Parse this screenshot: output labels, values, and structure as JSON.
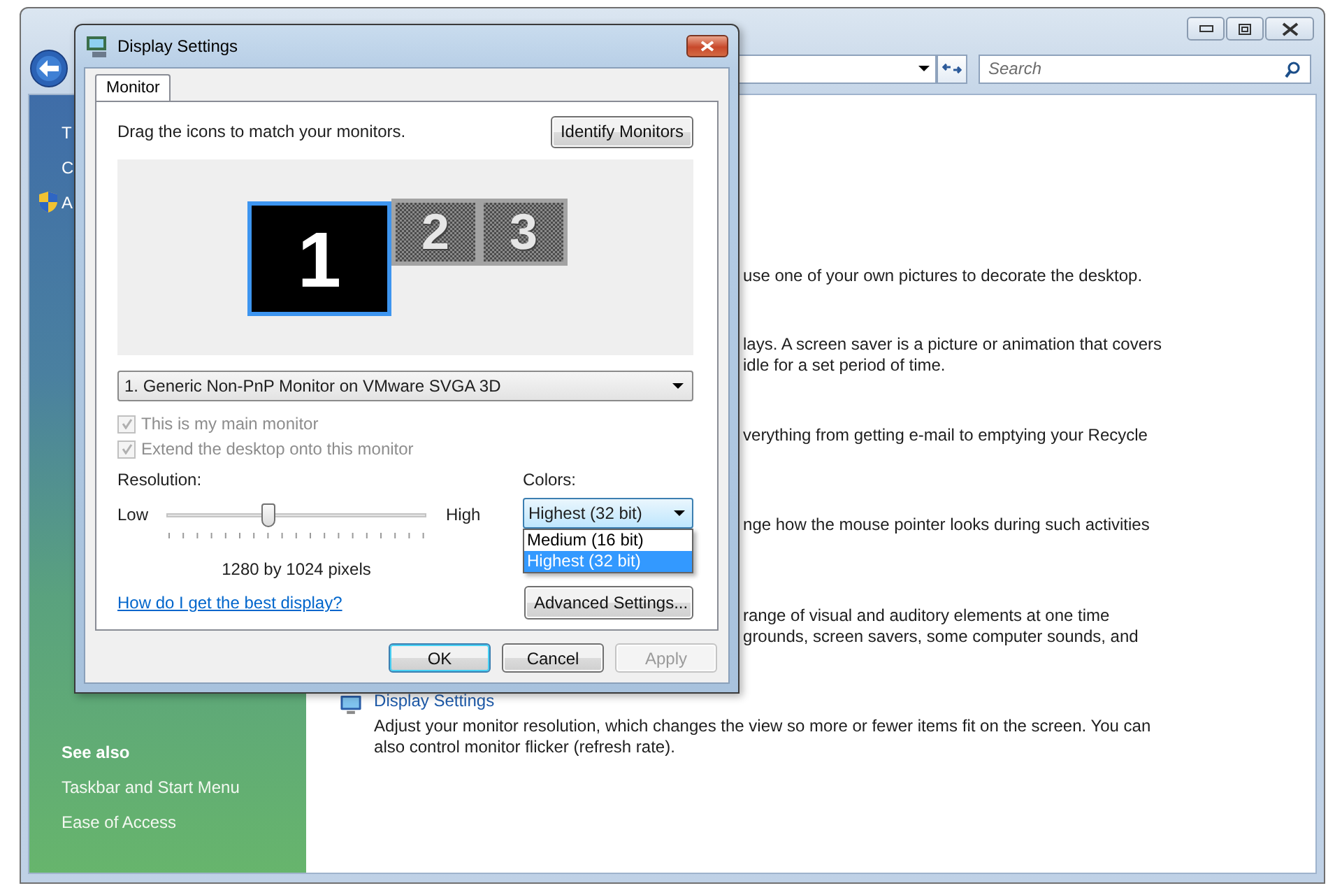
{
  "explorer": {
    "search": {
      "placeholder": "Search"
    },
    "sidebar": {
      "links": [
        {
          "text": "T",
          "kind": "plain"
        },
        {
          "text": "C",
          "kind": "plain"
        },
        {
          "text": "A",
          "kind": "shield"
        }
      ],
      "see_also_heading": "See also",
      "see_also": [
        "Taskbar and Start Menu",
        "Ease of Access"
      ]
    },
    "entries": [
      {
        "lines": [
          "use one of your own pictures to decorate the desktop."
        ]
      },
      {
        "lines": [
          "lays. A screen saver is a picture or animation that covers",
          "idle for a set period of time."
        ]
      },
      {
        "lines": [
          "verything from getting e-mail to emptying your Recycle"
        ]
      },
      {
        "lines": [
          "nge how the mouse pointer looks during such activities"
        ]
      },
      {
        "lines": [
          "range of visual and auditory elements at one time",
          "grounds, screen savers, some computer sounds, and"
        ]
      },
      {
        "title": "Display Settings",
        "description": "Adjust your monitor resolution, which changes the view so more or fewer items fit on the screen. You can also control monitor flicker (refresh rate)."
      }
    ]
  },
  "dialog": {
    "title": "Display Settings",
    "tabs": [
      {
        "label": "Monitor",
        "selected": true
      }
    ],
    "instruction": "Drag the icons to match your monitors.",
    "identify_button": "Identify Monitors",
    "monitors": [
      {
        "label": "1",
        "selected": true
      },
      {
        "label": "2",
        "selected": false
      },
      {
        "label": "3",
        "selected": false
      }
    ],
    "monitor_select": {
      "value": "1. Generic Non-PnP Monitor on VMware SVGA 3D"
    },
    "checkboxes": [
      {
        "label": "This is my main monitor",
        "checked": true,
        "disabled": true
      },
      {
        "label": "Extend the desktop onto this monitor",
        "checked": true,
        "disabled": true
      }
    ],
    "resolution": {
      "label": "Resolution:",
      "low": "Low",
      "high": "High",
      "level": 0.39,
      "reading": "1280 by 1024 pixels"
    },
    "colors": {
      "label": "Colors:",
      "value": "Highest (32 bit)",
      "expanded": true,
      "options": [
        {
          "label": "Medium (16 bit)",
          "selected": false
        },
        {
          "label": "Highest (32 bit)",
          "selected": true
        }
      ]
    },
    "help_link": "How do I get the best display?",
    "advanced_button": "Advanced Settings...",
    "buttons": [
      {
        "label": "OK",
        "kind": "default",
        "disabled": false
      },
      {
        "label": "Cancel",
        "kind": "normal",
        "disabled": false
      },
      {
        "label": "Apply",
        "kind": "normal",
        "disabled": true
      }
    ]
  }
}
